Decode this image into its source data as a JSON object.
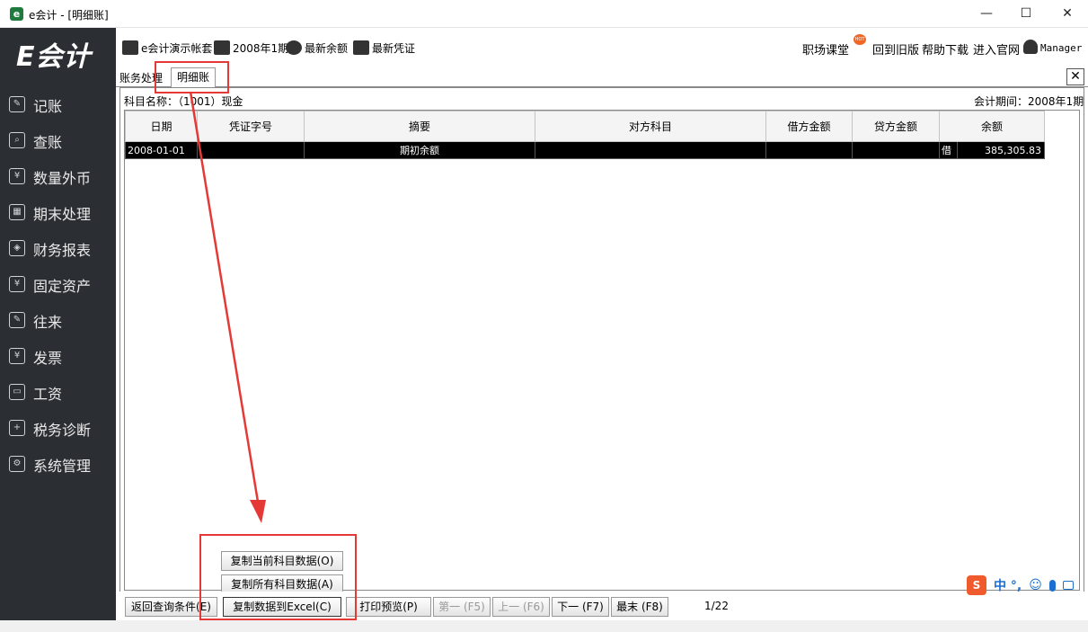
{
  "window": {
    "title": "e会计 - [明细账]",
    "app_icon": "e",
    "minimize": "—",
    "maximize": "☐",
    "close": "✕"
  },
  "sidebar": {
    "logo": "E会计",
    "items": [
      {
        "label": "记账",
        "icon": "edit-icon"
      },
      {
        "label": "查账",
        "icon": "search-doc-icon"
      },
      {
        "label": "数量外币",
        "icon": "yen-circle-icon"
      },
      {
        "label": "期末处理",
        "icon": "calendar-icon"
      },
      {
        "label": "财务报表",
        "icon": "cube-icon"
      },
      {
        "label": "固定资产",
        "icon": "asset-icon"
      },
      {
        "label": "往来",
        "icon": "wallet-edit-icon"
      },
      {
        "label": "发票",
        "icon": "invoice-icon"
      },
      {
        "label": "工资",
        "icon": "wallet-icon"
      },
      {
        "label": "税务诊断",
        "icon": "tax-icon"
      },
      {
        "label": "系统管理",
        "icon": "gear-icon"
      }
    ]
  },
  "toolbar": {
    "company": "e会计演示帐套",
    "period": "2008年1期",
    "latest_balance": "最新余额",
    "latest_voucher": "最新凭证",
    "career": "职场课堂",
    "hot_badge": "HOT",
    "old_version": "回到旧版",
    "help": "帮助下载",
    "website": "进入官网",
    "user": "Manager"
  },
  "tabs": [
    {
      "label": "账务处理"
    },
    {
      "label": "明细账"
    }
  ],
  "ledger": {
    "account_label": "科目名称：",
    "account_value": "（1001）现金",
    "period_label": "会计期间：",
    "period_value": "2008年1期",
    "columns": [
      "日期",
      "凭证字号",
      "摘要",
      "对方科目",
      "借方金额",
      "贷方金额",
      "余额"
    ],
    "rows": [
      {
        "date": "2008-01-01",
        "voucher": "",
        "summary": "期初余额",
        "counter": "",
        "debit": "",
        "credit": "",
        "dir": "借",
        "balance": "385,305.83"
      }
    ]
  },
  "popup_menu": {
    "copy_current": "复制当前科目数据(O)",
    "copy_all": "复制所有科目数据(A)"
  },
  "buttons": {
    "back": "返回查询条件(E)",
    "copy_excel": "复制数据到Excel(C)",
    "print": "打印预览(P)",
    "first": "第一 (F5)",
    "prev": "上一 (F6)",
    "next": "下一 (F7)",
    "last": "最末 (F8)"
  },
  "page_indicator": "1/22",
  "ime": {
    "logo": "S",
    "text": "中 °,"
  },
  "colors": {
    "sidebar": "#2b2f33",
    "annotation": "#e53935"
  }
}
